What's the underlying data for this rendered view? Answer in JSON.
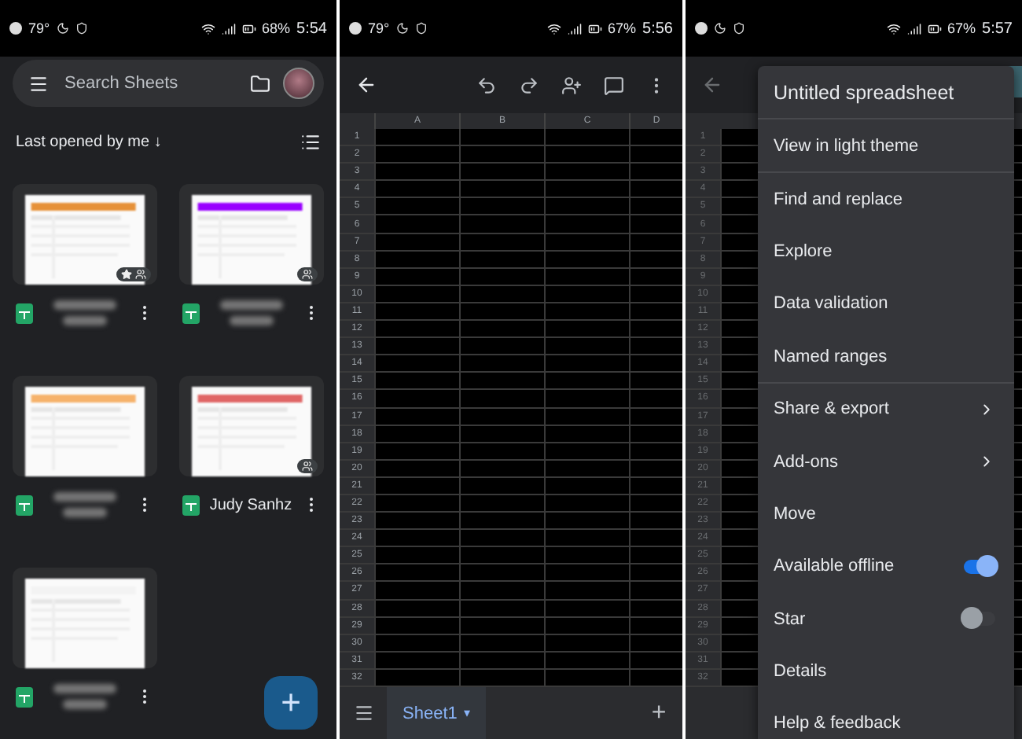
{
  "home": {
    "status": {
      "temp": "79°",
      "battery": "68%",
      "time": "5:54"
    },
    "search": {
      "placeholder": "Search Sheets"
    },
    "sort_label": "Last opened by me ↓",
    "files": [
      {
        "color": "#e69138",
        "starred": true,
        "shared": true
      },
      {
        "color": "#9900ff",
        "starred": false,
        "shared": true
      },
      {
        "color": "#f6b26b",
        "starred": false,
        "shared": false
      },
      {
        "color": "#e06666",
        "starred": false,
        "shared": true,
        "name": "Judy Sanhz"
      },
      {
        "color": "#f3f3f3",
        "starred": false,
        "shared": false
      }
    ],
    "fab": "+"
  },
  "editor": {
    "status": {
      "temp": "79°",
      "battery": "67%",
      "time": "5:56"
    },
    "columns": [
      "A",
      "B",
      "C",
      "D"
    ],
    "rows": [
      "1",
      "2",
      "3",
      "4",
      "5",
      "6",
      "7",
      "8",
      "9",
      "10",
      "11",
      "12",
      "13",
      "14",
      "15",
      "16",
      "17",
      "18",
      "19",
      "20",
      "21",
      "22",
      "23",
      "24",
      "25",
      "26",
      "27",
      "28",
      "29",
      "30",
      "31",
      "32"
    ],
    "sheet_tab": {
      "label": "Sheet1",
      "arrow": "▾",
      "selected": true
    },
    "add": "+"
  },
  "menu_screen": {
    "status": {
      "battery": "67%",
      "time": "5:57"
    },
    "rows": [
      "1",
      "2",
      "3",
      "4",
      "5",
      "6",
      "7",
      "8",
      "9",
      "10",
      "11",
      "12",
      "13",
      "14",
      "15",
      "16",
      "17",
      "18",
      "19",
      "20",
      "21",
      "22",
      "23",
      "24",
      "25",
      "26",
      "27",
      "28",
      "29",
      "30",
      "31",
      "32"
    ],
    "menu": {
      "title": "Untitled spreadsheet",
      "items": [
        {
          "label": "View in light theme",
          "kind": "plain",
          "divider_before": false
        },
        {
          "label": "Find and replace",
          "kind": "plain",
          "divider_before": true
        },
        {
          "label": "Explore",
          "kind": "plain",
          "divider_before": false
        },
        {
          "label": "Data validation",
          "kind": "plain",
          "divider_before": false
        },
        {
          "label": "Named ranges",
          "kind": "plain",
          "divider_before": false
        },
        {
          "label": "Share & export",
          "kind": "submenu",
          "divider_before": true
        },
        {
          "label": "Add-ons",
          "kind": "submenu",
          "divider_before": false
        },
        {
          "label": "Move",
          "kind": "plain",
          "divider_before": false
        },
        {
          "label": "Available offline",
          "kind": "toggle",
          "on": true,
          "divider_before": false
        },
        {
          "label": "Star",
          "kind": "toggle",
          "on": false,
          "divider_before": false
        },
        {
          "label": "Details",
          "kind": "plain",
          "divider_before": false
        },
        {
          "label": "Help & feedback",
          "kind": "plain",
          "divider_before": false
        }
      ]
    }
  }
}
